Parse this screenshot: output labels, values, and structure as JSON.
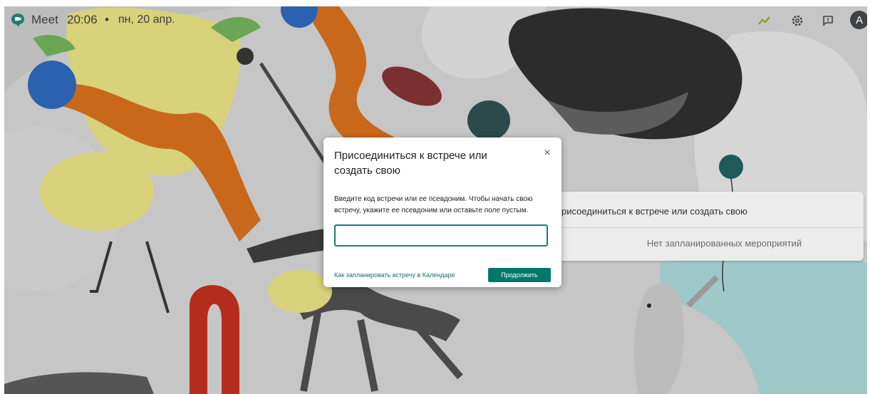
{
  "header": {
    "app_name": "Meet",
    "time": "20:06",
    "separator": "•",
    "date": "пн, 20 апр.",
    "icons": [
      "meet-logo-icon",
      "activity-chart-icon",
      "settings-gear-icon",
      "feedback-icon"
    ],
    "avatar_letter": "A"
  },
  "side_card": {
    "join_or_create_label": "рисоединиться к встрече или создать свою",
    "no_events_text": "Нет запланированных мероприятий"
  },
  "dialog": {
    "title": "Присоединиться к встрече или создать свою",
    "close_symbol": "×",
    "description": "Введите код встречи или ее псевдоним. Чтобы начать свою встречу, укажите ее псевдоним или оставьте поле пустым.",
    "input_value": "",
    "input_placeholder": "",
    "calendar_link": "Как запланировать встречу в Календаре",
    "continue_button": "Продолжить"
  },
  "colors": {
    "accent": "#00796b",
    "input_border": "#1a7b73",
    "avatar_bg": "#404244",
    "background": "#c9c9c9"
  }
}
